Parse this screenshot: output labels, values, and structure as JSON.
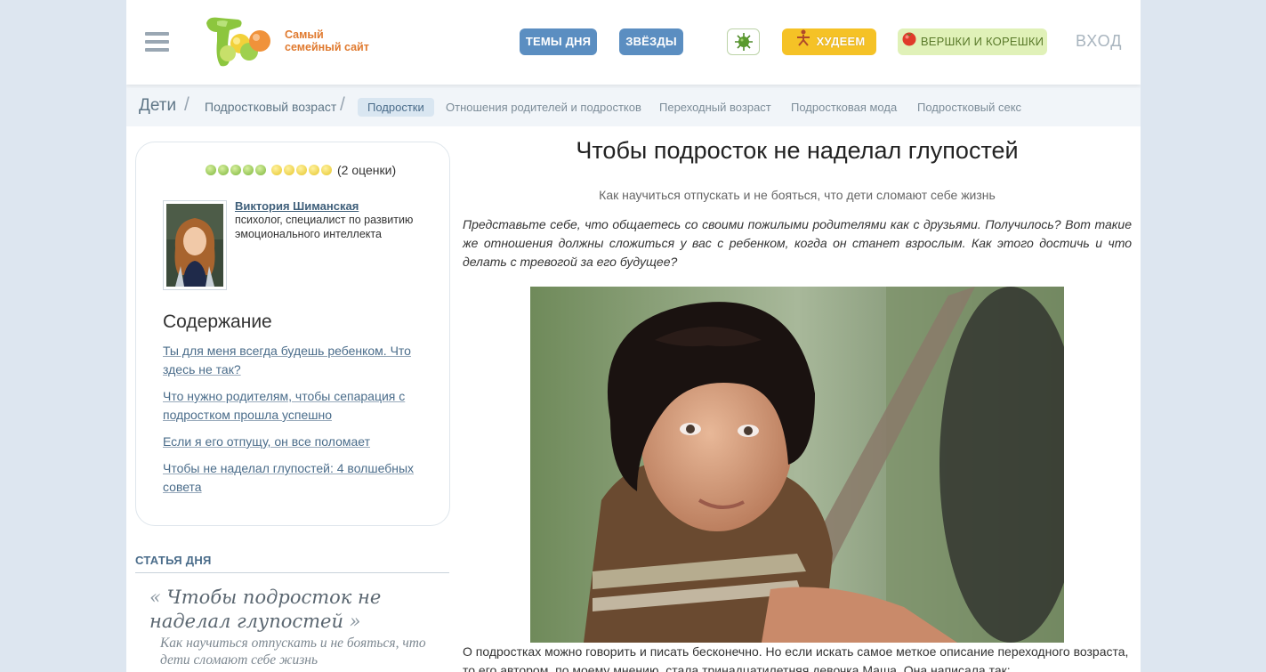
{
  "header": {
    "logo_text_1": "Самый",
    "logo_text_2": "семейный сайт",
    "buttons": {
      "temy": "ТЕМЫ ДНЯ",
      "zvezdy": "ЗВЁЗДЫ",
      "hudeem": "ХУДЕЕМ",
      "vershki": "ВЕРШКИ И КОРЕШКИ"
    },
    "login": "ВХОД"
  },
  "breadcrumbs": {
    "root": "Дети",
    "sub": "Подростковый возраст",
    "tabs": [
      "Подростки",
      "Отношения родителей и подростков",
      "Переходный возраст",
      "Подростковая мода",
      "Подростковый секс"
    ]
  },
  "rating": {
    "green_stars": 5,
    "yellow_stars": 5,
    "text": "(2 оценки)"
  },
  "author": {
    "name": "Виктория Шиманская",
    "description": "психолог, специалист по развитию эмоционального интеллекта"
  },
  "toc": {
    "title": "Содержание",
    "items": [
      "Ты для меня всегда будешь ребенком. Что здесь не так?",
      "Что нужно родителям, чтобы сепарация с подростком прошла успешно",
      "Если я его отпущу, он все поломает",
      "Чтобы не наделал глупостей: 4 волшебных совета"
    ]
  },
  "article_of_day": {
    "label": "СТАТЬЯ ДНЯ",
    "title": "Чтобы подросток не наделал глупостей",
    "subtitle": "Как научиться отпускать и не бояться, что дети сломают себе жизнь"
  },
  "article": {
    "title": "Чтобы подросток не наделал глупостей",
    "subtitle": "Как научиться отпускать и не бояться, что дети сломают себе жизнь",
    "lead": "Представьте себе, что общаетесь со своими пожилыми родителями как с друзьями. Получилось? Вот такие же отношения должны сложиться у вас с ребенком, когда он станет взрослым. Как этого достичь и что делать с тревогой за его будущее?",
    "body": "О подростках можно говорить и писать бесконечно. Но если искать самое меткое описание переходного возраста, то его автором, по моему мнению, стала тринадцатилетняя девочка Маша. Она написала так:"
  }
}
